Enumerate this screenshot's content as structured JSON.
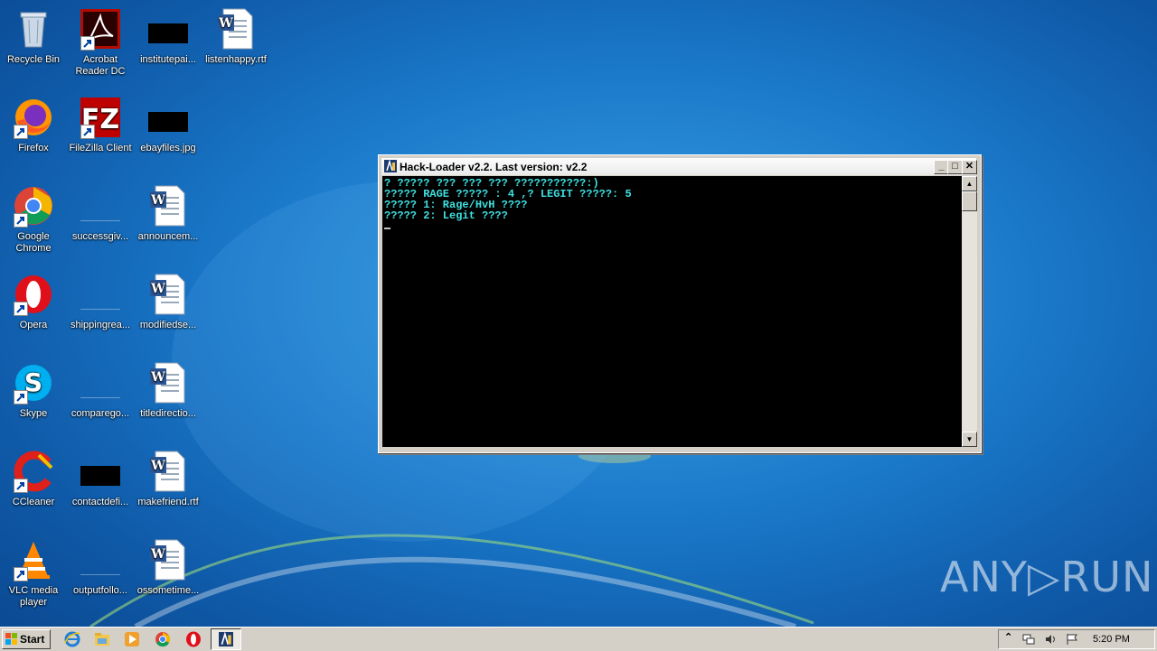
{
  "desktop": {
    "icons": [
      {
        "label": "Recycle Bin"
      },
      {
        "label": "Acrobat Reader DC"
      },
      {
        "label": "institutepai..."
      },
      {
        "label": "listenhappy.rtf"
      },
      {
        "label": "Firefox"
      },
      {
        "label": "FileZilla Client"
      },
      {
        "label": "ebayfiles.jpg"
      },
      {
        "label": "Google Chrome"
      },
      {
        "label": "successgiv..."
      },
      {
        "label": "announcem..."
      },
      {
        "label": "Opera"
      },
      {
        "label": "shippingrea..."
      },
      {
        "label": "modifiedse..."
      },
      {
        "label": "Skype"
      },
      {
        "label": "comparego..."
      },
      {
        "label": "titledirectio..."
      },
      {
        "label": "CCleaner"
      },
      {
        "label": "contactdefi..."
      },
      {
        "label": "makefriend.rtf"
      },
      {
        "label": "VLC media player"
      },
      {
        "label": "outputfollo..."
      },
      {
        "label": "ossometime..."
      }
    ]
  },
  "window": {
    "title": "Hack-Loader v2.2. Last version: v2.2",
    "minimize": "_",
    "maximize": "□",
    "close": "✕",
    "lines": [
      "? ????? ??? ??? ??? ???????????:)",
      "????? RAGE ????? : 4 ,? LEGIT ?????: 5",
      "????? 1: Rage/HvH ????",
      "????? 2: Legit ????"
    ],
    "scroll_up": "▲",
    "scroll_down": "▼"
  },
  "watermark": "ANY▷RUN",
  "taskbar": {
    "start_label": "Start",
    "clock": "5:20 PM",
    "tray_expand": "⌃"
  }
}
